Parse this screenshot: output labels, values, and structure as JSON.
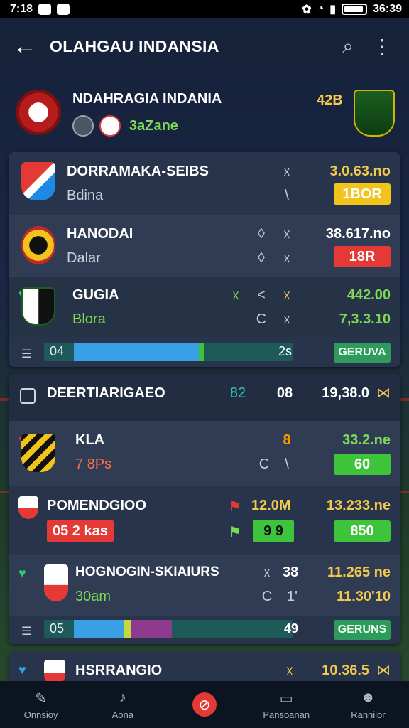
{
  "status_bar": {
    "time": "7:18",
    "clock": "36:39"
  },
  "app_bar": {
    "title": "OLAHGAU INDANSIA"
  },
  "team_header": {
    "name": "NDAHRAGIA INDANIA",
    "score": "42B",
    "zone": "3aZane"
  },
  "card1": {
    "rows": [
      {
        "name": "DORRAMAKA-SEIBS",
        "sub": "Bdina",
        "sym1": "☓",
        "sym2": "\\",
        "value": "3.0.63.no",
        "pill": "1BOR",
        "pill_color": "#f2c31a"
      },
      {
        "name": "HANODAI",
        "sub": "Dalar",
        "sym1": "◊",
        "sym1b": "☓",
        "sym2": "◊",
        "sym2b": "☓",
        "value": "38.617.no",
        "pill": "18R",
        "pill_color": "#e53935"
      },
      {
        "name": "GUGIA",
        "sub": "Blora",
        "sym0": "☓",
        "sym1": "<",
        "sym1b": "☓",
        "sym2": "C",
        "sym2b": "☓",
        "value": "442.00",
        "value2": "7,3.3.10"
      }
    ],
    "bar": {
      "label": "04",
      "number": "2s",
      "button": "GERUVA"
    }
  },
  "card2": {
    "header": {
      "name": "DEERTIARIGAEO",
      "sym": "82",
      "num": "08",
      "value": "19,38.0"
    },
    "rows": [
      {
        "name": "KLA",
        "sub": "7 8Ps",
        "num": "8",
        "sym": "C",
        "symb": "\\",
        "value": "33.2.ne",
        "pill": "60",
        "pill_color": "#3ec43a"
      },
      {
        "name": "POMENDGIOO",
        "badge": "05 2 kas",
        "num": "12.0M",
        "pill_mid": "9 9",
        "value": "13.233.ne",
        "pill": "850",
        "pill_color": "#3ec43a"
      },
      {
        "name": "HOGNOGIN-SKIAIURS",
        "sub": "30am",
        "sym": "☓",
        "num": "38",
        "sym2": "C",
        "num2": "1'",
        "value": "11.265 ne",
        "value2": "11.30'10"
      }
    ],
    "bar": {
      "label": "05",
      "number": "49",
      "button": "GERUNS"
    }
  },
  "card3": {
    "name": "HSRRANGIO",
    "sym": "☓",
    "value": "10.36.5"
  },
  "bottom_nav": [
    {
      "label": "Onnsioy",
      "icon": "edit-icon"
    },
    {
      "label": "Aona",
      "icon": "whistle-icon"
    },
    {
      "label": "",
      "icon": "ban-icon"
    },
    {
      "label": "Pansoanan",
      "icon": "inbox-icon"
    },
    {
      "label": "Rannilor",
      "icon": "user-icon"
    }
  ],
  "colors": {
    "accent_yellow": "#f2c94c",
    "accent_green": "#7ed957",
    "accent_red": "#e53935"
  }
}
